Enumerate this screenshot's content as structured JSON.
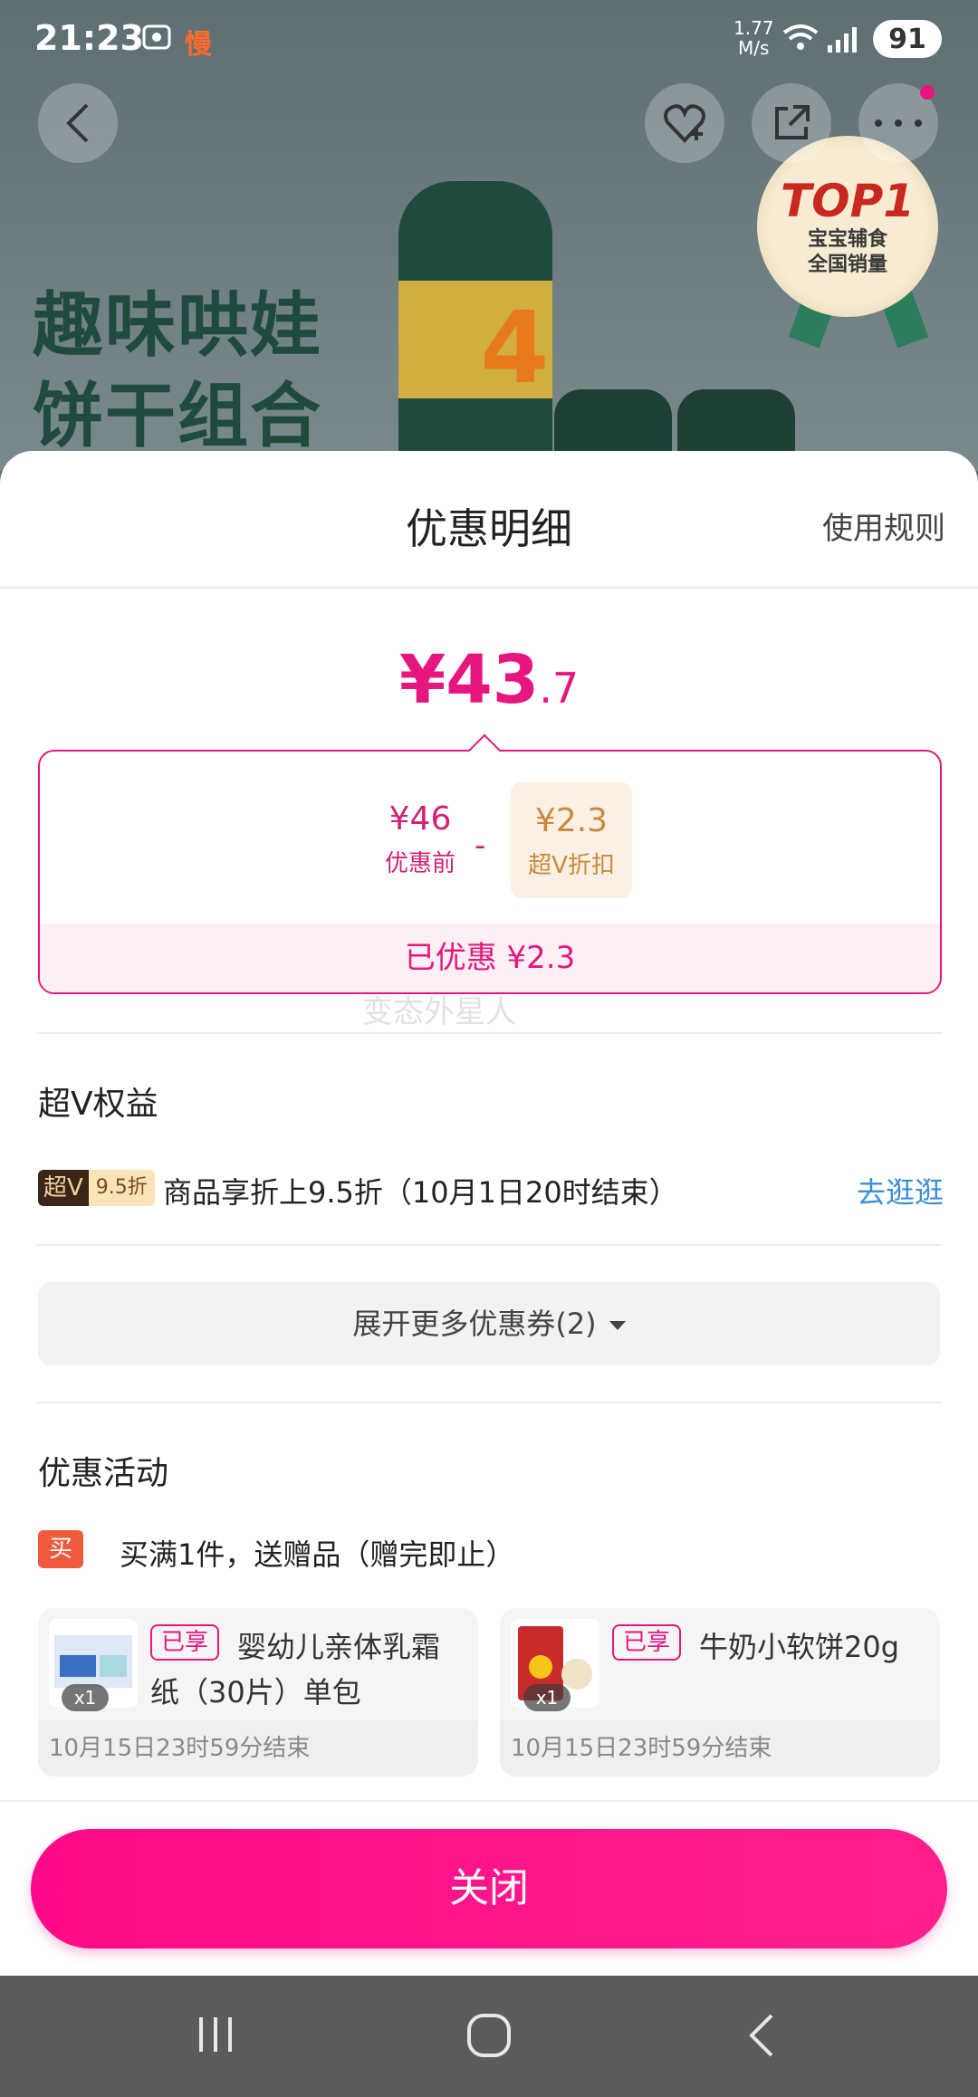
{
  "status_bar": {
    "time": "21:23",
    "speed": "1.77\nM/s",
    "battery": "91"
  },
  "banner": {
    "title_line1": "趣味哄娃",
    "title_line2": "饼干组合",
    "badge_top": "TOP1",
    "badge_line1": "宝宝辅食",
    "badge_line2": "全国销量"
  },
  "sheet": {
    "title": "优惠明细",
    "rules_link": "使用规则",
    "total_price_main": "¥43",
    "total_price_decimal": ".7",
    "before_price": "¥46",
    "before_label": "优惠前",
    "minus": "-",
    "discount_value": "¥2.3",
    "discount_label": "超V折扣",
    "saved_text": "已优惠 ¥2.3",
    "watermark": "变态外星人"
  },
  "super_v": {
    "heading": "超V权益",
    "tag_a": "超V",
    "tag_b": "9.5折",
    "benefit": "商品享折上9.5折（10月1日20时结束）",
    "go_link": "去逛逛"
  },
  "expand_coupons": {
    "label": "展开更多优惠券(2)"
  },
  "promotions": {
    "heading": "优惠活动",
    "gift_tag": "买赠",
    "gift_text": "买满1件，送赠品（赠完即止）",
    "items": [
      {
        "enjoyed": "已享",
        "name": "婴幼儿亲体乳霜纸（30片）单包",
        "qty": "x1",
        "end": "10月15日23时59分结束"
      },
      {
        "enjoyed": "已享",
        "name": "牛奶小软饼20g",
        "qty": "x1",
        "end": "10月15日23时59分结束"
      }
    ]
  },
  "footer": {
    "close_label": "关闭"
  },
  "colors": {
    "accent": "#e5177f",
    "discount_gold": "#c88a3c",
    "link_blue": "#3b8fd6"
  }
}
